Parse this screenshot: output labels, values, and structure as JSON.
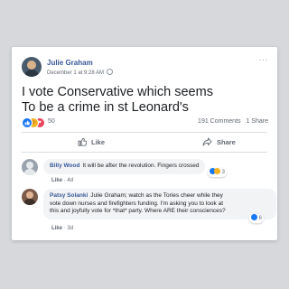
{
  "post": {
    "author": "Julie Graham",
    "date": "December 1 at 9:28 AM",
    "text_line1": "I vote Conservative which seems",
    "text_line2": "To be a crime in st Leonard's",
    "reaction_count": "50",
    "comments_count": "191 Comments",
    "shares_count": "1 Share",
    "more_icon": "···"
  },
  "actions": {
    "like_label": "Like",
    "share_label": "Share"
  },
  "comments": [
    {
      "author": "Billy Wood",
      "text": "It will be after the revolution. Fingers crossed",
      "like_label": "Like",
      "time": "4d",
      "reaction_count": "3"
    },
    {
      "author": "Patsy Solanki",
      "line1": "Julie Graham; watch as the Tories cheer while they",
      "line2": "vote down nurses and firefighters funding. I'm asking you to look at",
      "line3": "this and joyfully vote for *that* party. Where ARE their consciences?",
      "like_label": "Like",
      "time": "3d",
      "reaction_count": "6"
    }
  ],
  "colors": {
    "name_link": "#385898",
    "like_blue": "#1877f2",
    "love_red": "#e9445a",
    "haha_yellow": "#f7b125",
    "background": "#d6d8dc"
  },
  "icons": [
    "more-options-icon",
    "globe-icon",
    "like-reaction-icon",
    "haha-reaction-icon",
    "love-reaction-icon",
    "thumbs-up-icon",
    "share-arrow-icon"
  ]
}
